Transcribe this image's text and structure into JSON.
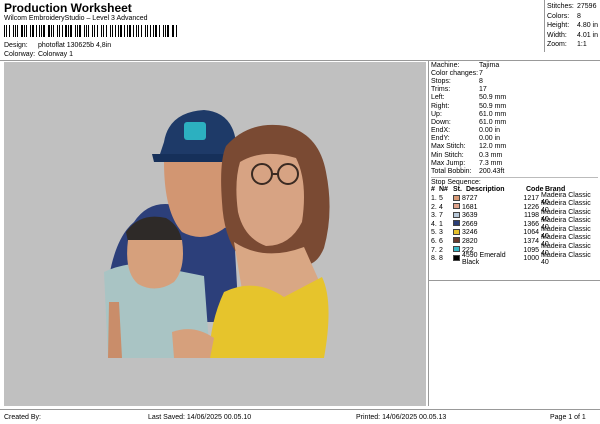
{
  "header": {
    "title": "Production Worksheet",
    "subtitle": "Wilcom EmbroideryStudio – Level 3 Advanced",
    "design_label": "Design:",
    "design_value": "photoflat 130625b 4,8in",
    "colorway_label": "Colorway:",
    "colorway_value": "Colorway 1"
  },
  "stats": [
    {
      "k": "Stitches:",
      "v": "27596"
    },
    {
      "k": "Colors:",
      "v": "8"
    },
    {
      "k": "Height:",
      "v": "4.80 in"
    },
    {
      "k": "Width:",
      "v": "4.01 in"
    },
    {
      "k": "Zoom:",
      "v": "1:1"
    }
  ],
  "machine": [
    {
      "k": "Machine:",
      "v": "Tajima"
    },
    {
      "k": "Color changes:",
      "v": "7"
    },
    {
      "k": "Stops:",
      "v": "8"
    },
    {
      "k": "Trims:",
      "v": "17"
    },
    {
      "k": "Left:",
      "v": "50.9 mm"
    },
    {
      "k": "Right:",
      "v": "50.9 mm"
    },
    {
      "k": "Up:",
      "v": "61.0 mm"
    },
    {
      "k": "Down:",
      "v": "61.0 mm"
    },
    {
      "k": "EndX:",
      "v": "0.00 in"
    },
    {
      "k": "EndY:",
      "v": "0.00 in"
    },
    {
      "k": "Max Stitch:",
      "v": "12.0 mm"
    },
    {
      "k": "Min Stitch:",
      "v": "0.3 mm"
    },
    {
      "k": "Max Jump:",
      "v": "7.3 mm"
    },
    {
      "k": "Total Bobbin:",
      "v": "200.43ft"
    }
  ],
  "stop_sequence": {
    "title": "Stop Sequence:",
    "headers": [
      "#",
      "N#",
      "St.",
      "Description",
      "Code",
      "Brand"
    ],
    "rows": [
      {
        "n": "1.",
        "nn": "5",
        "color": "#d99a76",
        "code": "8727",
        "desc": "",
        "st": "1217",
        "brand": "Madeira Classic 40"
      },
      {
        "n": "2.",
        "nn": "4",
        "color": "#e0a48c",
        "code": "1681",
        "desc": "",
        "st": "1226",
        "brand": "Madeira Classic 40"
      },
      {
        "n": "3.",
        "nn": "7",
        "color": "#b8c8d8",
        "code": "3639",
        "desc": "",
        "st": "1198",
        "brand": "Madeira Classic 40"
      },
      {
        "n": "4.",
        "nn": "1",
        "color": "#2b3e78",
        "code": "2669",
        "desc": "",
        "st": "1366",
        "brand": "Madeira Classic 40"
      },
      {
        "n": "5.",
        "nn": "3",
        "color": "#e8c22a",
        "code": "3246",
        "desc": "",
        "st": "1064",
        "brand": "Madeira Classic 40"
      },
      {
        "n": "6.",
        "nn": "6",
        "color": "#6a3a2e",
        "code": "2820",
        "desc": "",
        "st": "1374",
        "brand": "Madeira Classic 40"
      },
      {
        "n": "7.",
        "nn": "2",
        "color": "#39b8c8",
        "code": "222",
        "desc": "",
        "st": "1095",
        "brand": "Madeira Classic 40"
      },
      {
        "n": "8.",
        "nn": "8",
        "color": "#000000",
        "code": "4590",
        "desc": "Emerald Black",
        "st": "1000",
        "brand": "Madeira Classic 40"
      }
    ]
  },
  "footer": {
    "created": "Created By:",
    "saved": "Last Saved: 14/06/2025 00.05.10",
    "printed": "Printed: 14/06/2025 00.05.13",
    "page": "Page 1 of 1"
  }
}
